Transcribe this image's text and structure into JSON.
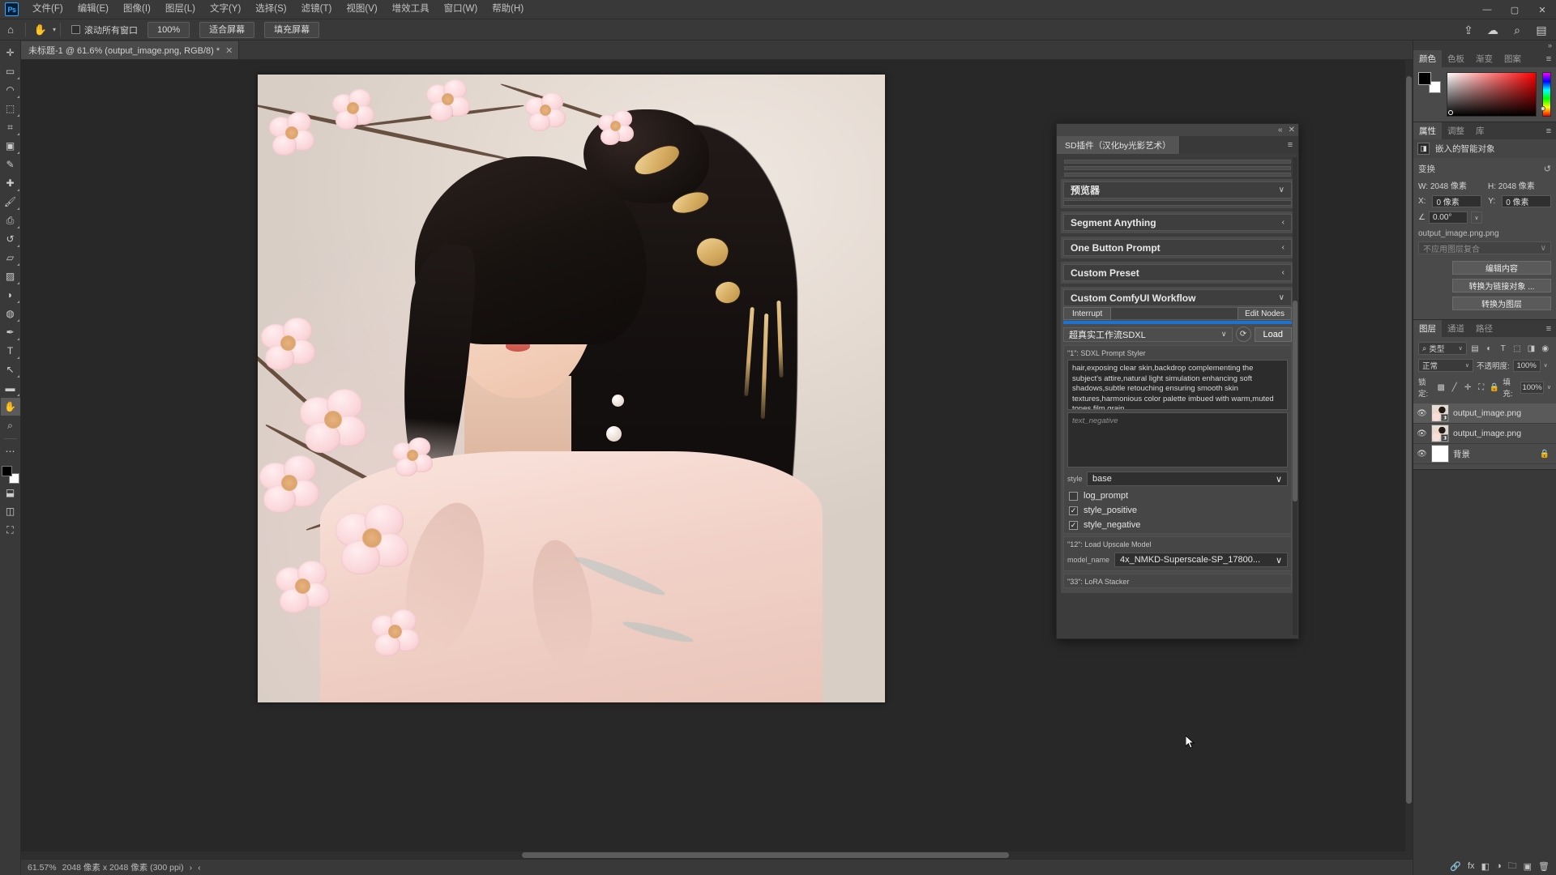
{
  "app": {
    "logo": "Ps",
    "menus": [
      "文件(F)",
      "编辑(E)",
      "图像(I)",
      "图层(L)",
      "文字(Y)",
      "选择(S)",
      "滤镜(T)",
      "视图(V)",
      "增效工具",
      "窗口(W)",
      "帮助(H)"
    ],
    "window_buttons": {
      "minimize": "—",
      "maximize": "▢",
      "close": "✕"
    }
  },
  "options_bar": {
    "home_icon": "home-icon",
    "tool_icon": "hand-tool-icon",
    "tool_chevron": "▾",
    "scroll_all_windows": "滚动所有窗口",
    "buttons": [
      "100%",
      "适合屏幕",
      "填充屏幕"
    ],
    "right_icons": [
      "share-icon",
      "cloud-icon",
      "search-icon",
      "workspace-icon"
    ]
  },
  "document": {
    "tab_title": "未标题-1 @ 61.6% (output_image.png, RGB/8) *",
    "tab_close": "✕"
  },
  "status_bar": {
    "zoom": "61.57%",
    "dimensions": "2048 像素 x 2048 像素 (300 ppi)",
    "arrow": "›",
    "chevron": "‹"
  },
  "toolbar": {
    "tools": [
      "move-tool-icon",
      "marquee-tool-icon",
      "lasso-tool-icon",
      "object-select-tool-icon",
      "crop-tool-icon",
      "frame-tool-icon",
      "eyedropper-tool-icon",
      "healing-brush-tool-icon",
      "brush-tool-icon",
      "clone-stamp-tool-icon",
      "history-brush-tool-icon",
      "eraser-tool-icon",
      "gradient-tool-icon",
      "blur-tool-icon",
      "dodge-tool-icon",
      "pen-tool-icon",
      "type-tool-icon",
      "path-selection-tool-icon",
      "shape-tool-icon",
      "hand-tool-icon",
      "zoom-tool-icon"
    ],
    "extras": [
      "edit-toolbar-icon",
      "default-colors-icon",
      "quick-mask-icon",
      "screen-mode-icon"
    ]
  },
  "sd_panel": {
    "tab_label": "SD插件（汉化by光影艺术）",
    "collapse_icon": "«",
    "close_icon": "✕",
    "menu_icon": "≡",
    "accordions": [
      {
        "label": "预览器",
        "arrow": "∨",
        "expanded": true
      },
      {
        "label": "Segment Anything",
        "arrow": "‹",
        "expanded": false
      },
      {
        "label": "One Button Prompt",
        "arrow": "‹",
        "expanded": false
      },
      {
        "label": "Custom Preset",
        "arrow": "‹",
        "expanded": false
      },
      {
        "label": "Custom ComfyUI Workflow",
        "arrow": "∨",
        "expanded": true
      }
    ],
    "workflow": {
      "interrupt_button": "Interrupt",
      "edit_nodes_button": "Edit Nodes",
      "progress_percent": 100,
      "progress_color": "#1b72d0",
      "selected_workflow": "超真实工作流SDXL",
      "workflow_chevron": "∨",
      "refresh_icon": "refresh-icon",
      "load_button": "Load"
    },
    "nodes": [
      {
        "id": "\"1\": SDXL Prompt Styler",
        "positive_prompt": "hair,exposing clear skin,backdrop complementing the subject's attire,natural light simulation enhancing soft shadows,subtle retouching ensuring smooth skin textures,harmonious color palette imbued with warm,muted tones,film grain,",
        "negative_placeholder": "text_negative",
        "style_label": "style",
        "style_value": "base",
        "style_chevron": "∨",
        "checkboxes": [
          {
            "label": "log_prompt",
            "checked": false
          },
          {
            "label": "style_positive",
            "checked": true
          },
          {
            "label": "style_negative",
            "checked": true
          }
        ]
      },
      {
        "id": "\"12\": Load Upscale Model",
        "model_label": "model_name",
        "model_value": "4x_NMKD-Superscale-SP_17800...",
        "model_chevron": "∨"
      },
      {
        "id": "\"33\": LoRA Stacker"
      }
    ]
  },
  "dock": {
    "collapse_icon": "»",
    "color_panel": {
      "tabs": [
        "颜色",
        "色板",
        "渐变",
        "图案"
      ],
      "active_tab": "颜色",
      "menu_icon": "≡",
      "foreground": "#000000",
      "background": "#ffffff"
    },
    "properties_panel": {
      "tabs": [
        "属性",
        "调整",
        "库"
      ],
      "active_tab": "属性",
      "menu_icon": "≡",
      "object_type": "嵌入的智能对象",
      "object_icon": "smart-object-icon",
      "transform_title": "变换",
      "reset_icon": "reset-icon",
      "width_label": "W:",
      "width_value": "2048 像素",
      "height_label": "H:",
      "height_value": "2048 像素",
      "x_label": "X:",
      "x_value": "0 像素",
      "y_label": "Y:",
      "y_value": "0 像素",
      "angle_icon": "angle-icon",
      "angle_value": "0.00°",
      "angle_chevron": "∨",
      "filename": "output_image.png.png",
      "layer_comp": "不应用图层复合",
      "layer_comp_chevron": "∨",
      "buttons": [
        "编辑内容",
        "转换为链接对象 ...",
        "转换为图层"
      ]
    },
    "layers_panel": {
      "tabs": [
        "图层",
        "通道",
        "路径"
      ],
      "active_tab": "图层",
      "menu_icon": "≡",
      "filter_icon": "search-icon",
      "filter_label": "类型",
      "filter_chevron": "∨",
      "filter_icons": [
        "pixel-filter-icon",
        "adjustment-filter-icon",
        "type-filter-icon",
        "shape-filter-icon",
        "smart-object-filter-icon",
        "toggle-filters-icon"
      ],
      "blend_mode": "正常",
      "blend_chevron": "∨",
      "opacity_label": "不透明度:",
      "opacity_value": "100%",
      "opacity_chevron": "∨",
      "lock_label": "锁定:",
      "lock_icons": [
        "lock-transparent-icon",
        "lock-image-icon",
        "lock-position-icon",
        "lock-nesting-icon",
        "lock-all-icon"
      ],
      "fill_label": "填充:",
      "fill_value": "100%",
      "fill_chevron": "∨",
      "layers": [
        {
          "name": "output_image.png",
          "visible": true,
          "selected": true,
          "locked": false,
          "kind": "smart-object"
        },
        {
          "name": "output_image.png",
          "visible": true,
          "selected": false,
          "locked": false,
          "kind": "smart-object"
        },
        {
          "name": "背景",
          "visible": true,
          "selected": false,
          "locked": true,
          "kind": "background"
        }
      ],
      "footer_icons": [
        "link-layers-icon",
        "layer-style-icon",
        "layer-mask-icon",
        "adjustment-layer-icon",
        "new-group-icon",
        "new-layer-icon",
        "delete-layer-icon"
      ]
    }
  },
  "canvas": {
    "artwork_description": "woman-with-cherry-blossoms-photo",
    "zoom_percent": "61.6%"
  }
}
